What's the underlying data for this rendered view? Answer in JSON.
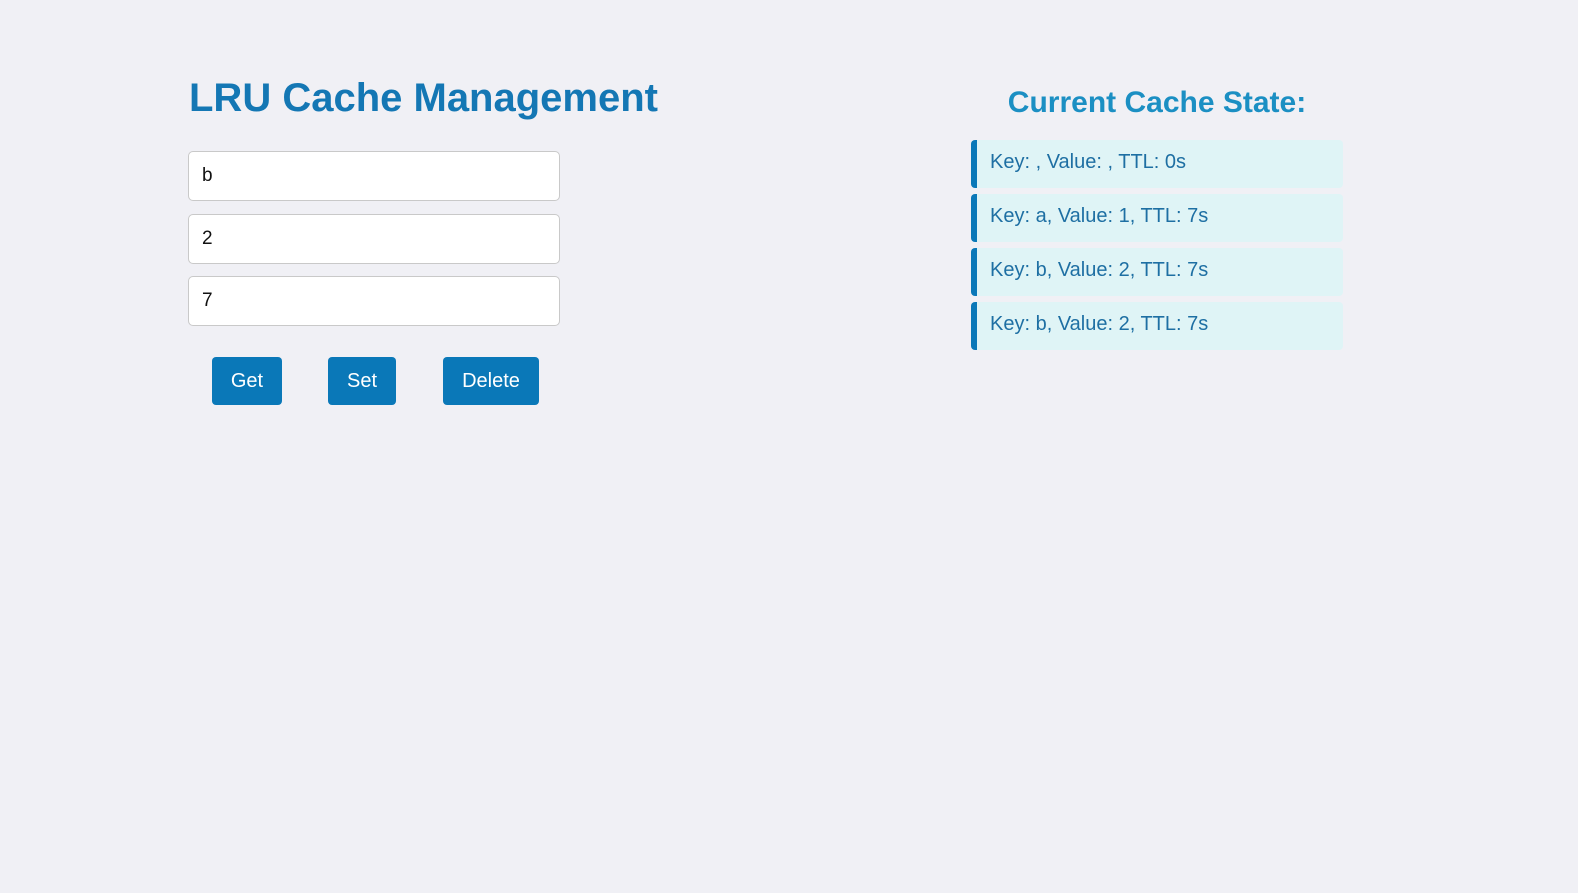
{
  "header": {
    "title": "LRU Cache Management"
  },
  "form": {
    "key_value": "b",
    "value_value": "2",
    "ttl_value": "7"
  },
  "buttons": {
    "get_label": "Get",
    "set_label": "Set",
    "delete_label": "Delete"
  },
  "cache": {
    "title": "Current Cache State:",
    "items": [
      {
        "text": "Key: , Value: , TTL: 0s"
      },
      {
        "text": "Key: a, Value: 1, TTL: 7s"
      },
      {
        "text": "Key: b, Value: 2, TTL: 7s"
      },
      {
        "text": "Key: b, Value: 2, TTL: 7s"
      }
    ]
  },
  "colors": {
    "background": "#f0f0f5",
    "accent": "#0a78b8",
    "title": "#1477b4",
    "cache_title": "#1b8fc3",
    "cache_item_bg": "#dff4f6",
    "cache_item_text": "#1e6fa3"
  }
}
